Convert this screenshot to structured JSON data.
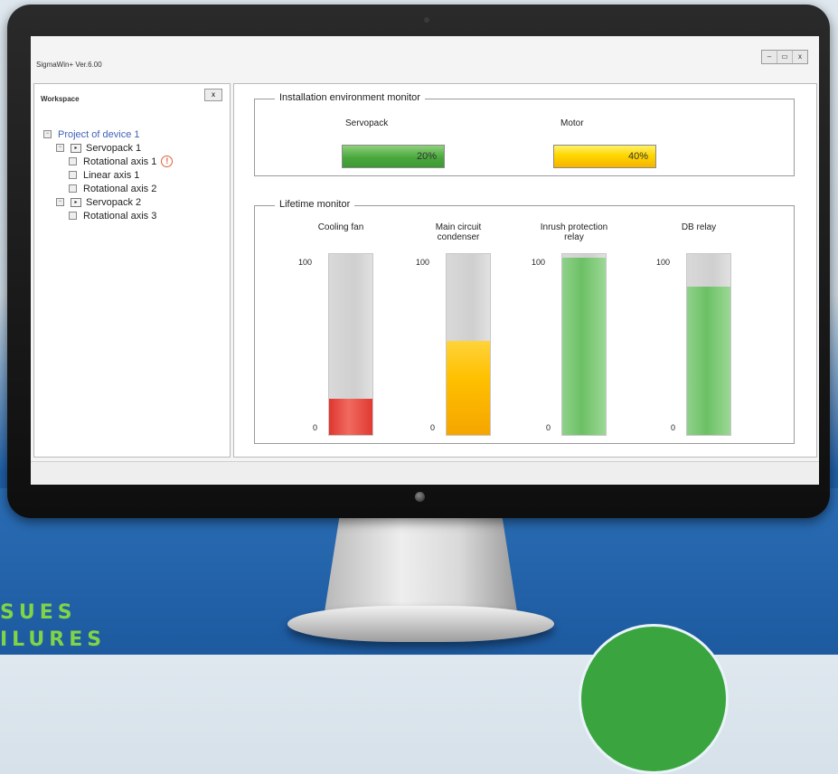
{
  "app": {
    "title": "SigmaWin+ Ver.6.00"
  },
  "window_controls": {
    "minimize": "–",
    "restore": "▭",
    "close": "x"
  },
  "workspace": {
    "title": "Workspace",
    "close_label": "x",
    "tree": [
      {
        "label": "Project of device 1",
        "level": 0,
        "type": "root"
      },
      {
        "label": "Servopack 1",
        "level": 1,
        "type": "servopack"
      },
      {
        "label": "Rotational axis 1",
        "level": 2,
        "type": "axis",
        "warning": "!"
      },
      {
        "label": "Linear axis 1",
        "level": 2,
        "type": "axis"
      },
      {
        "label": "Rotational axis 2",
        "level": 2,
        "type": "axis"
      },
      {
        "label": "Servopack 2",
        "level": 1,
        "type": "servopack"
      },
      {
        "label": "Rotational axis 3",
        "level": 2,
        "type": "axis"
      }
    ]
  },
  "env_monitor": {
    "title": "Installation environment monitor",
    "servopack": {
      "label": "Servopack",
      "value_text": "20%",
      "value": 20,
      "color": "#49a83d"
    },
    "motor": {
      "label": "Motor",
      "value_text": "40%",
      "value": 40,
      "color": "#ffd600"
    }
  },
  "lifetime_monitor": {
    "title": "Lifetime monitor",
    "gauges": [
      {
        "title": "Cooling fan",
        "max_label": "100",
        "min_label": "0",
        "value": 20,
        "color": "#e0362f"
      },
      {
        "title": "Main circuit\ncondenser",
        "max_label": "100",
        "min_label": "0",
        "value": 52,
        "color": "#ffc000"
      },
      {
        "title": "Inrush protection\nrelay",
        "max_label": "100",
        "min_label": "0",
        "value": 98,
        "color": "#6cc065"
      },
      {
        "title": "DB relay",
        "max_label": "100",
        "min_label": "0",
        "value": 82,
        "color": "#6cc065"
      }
    ]
  },
  "promo": {
    "line1": "SUES",
    "line2": "ILURES"
  }
}
